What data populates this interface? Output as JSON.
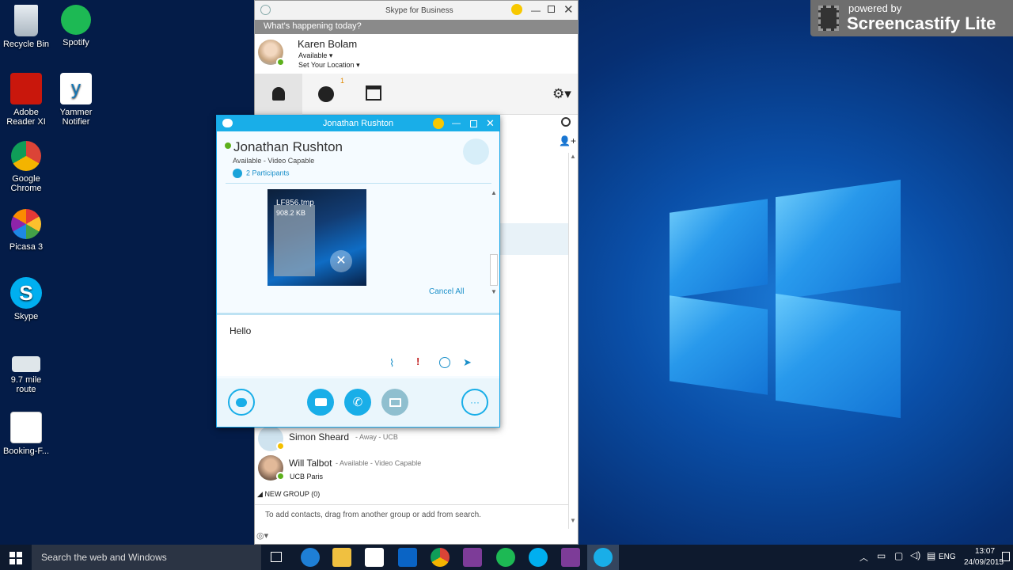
{
  "desktop": {
    "icons": [
      {
        "label": "Recycle Bin",
        "name": "recycle-bin-icon"
      },
      {
        "label": "Spotify",
        "name": "spotify-icon"
      },
      {
        "label": "Adobe Reader XI",
        "name": "adobe-reader-icon"
      },
      {
        "label": "Yammer Notifier",
        "name": "yammer-icon"
      },
      {
        "label": "Google Chrome",
        "name": "chrome-icon"
      },
      {
        "label": "Picasa 3",
        "name": "picasa-icon"
      },
      {
        "label": "Skype",
        "name": "skype-icon"
      },
      {
        "label": "9.7 mile route",
        "name": "route-file-icon"
      },
      {
        "label": "Booking-F...",
        "name": "booking-file-icon"
      }
    ]
  },
  "watermark": {
    "top": "powered by",
    "brand": "Screencastify Lite"
  },
  "main": {
    "title": "Skype for Business",
    "happening": "What's happening today?",
    "user": {
      "name": "Karen Bolam",
      "status": "Available",
      "location": "Set Your Location"
    },
    "recent_badge": "1",
    "contacts": [
      {
        "name": "Simon Sheard",
        "status": "- Away - UCB",
        "sub": ""
      },
      {
        "name": "Will Talbot",
        "status": "- Available - Video Capable",
        "sub": "UCB Paris"
      }
    ],
    "group": "NEW GROUP (0)",
    "add_hint": "To add contacts, drag from another group or add from search."
  },
  "conv": {
    "title": "Jonathan Rushton",
    "name": "Jonathan Rushton",
    "status": "Available - Video Capable",
    "participants": "2 Participants",
    "file_name": "LF856.tmp",
    "file_size": "908.2 KB",
    "cancel": "Cancel All",
    "message": "Hello"
  },
  "taskbar": {
    "search": "Search the web and Windows",
    "lang": "ENG",
    "time": "13:07",
    "date": "24/09/2015"
  },
  "colors": {
    "skype_blue": "#19aee8",
    "available": "#5db01c",
    "away": "#f4c000",
    "desktop": "#0a4fa8"
  }
}
